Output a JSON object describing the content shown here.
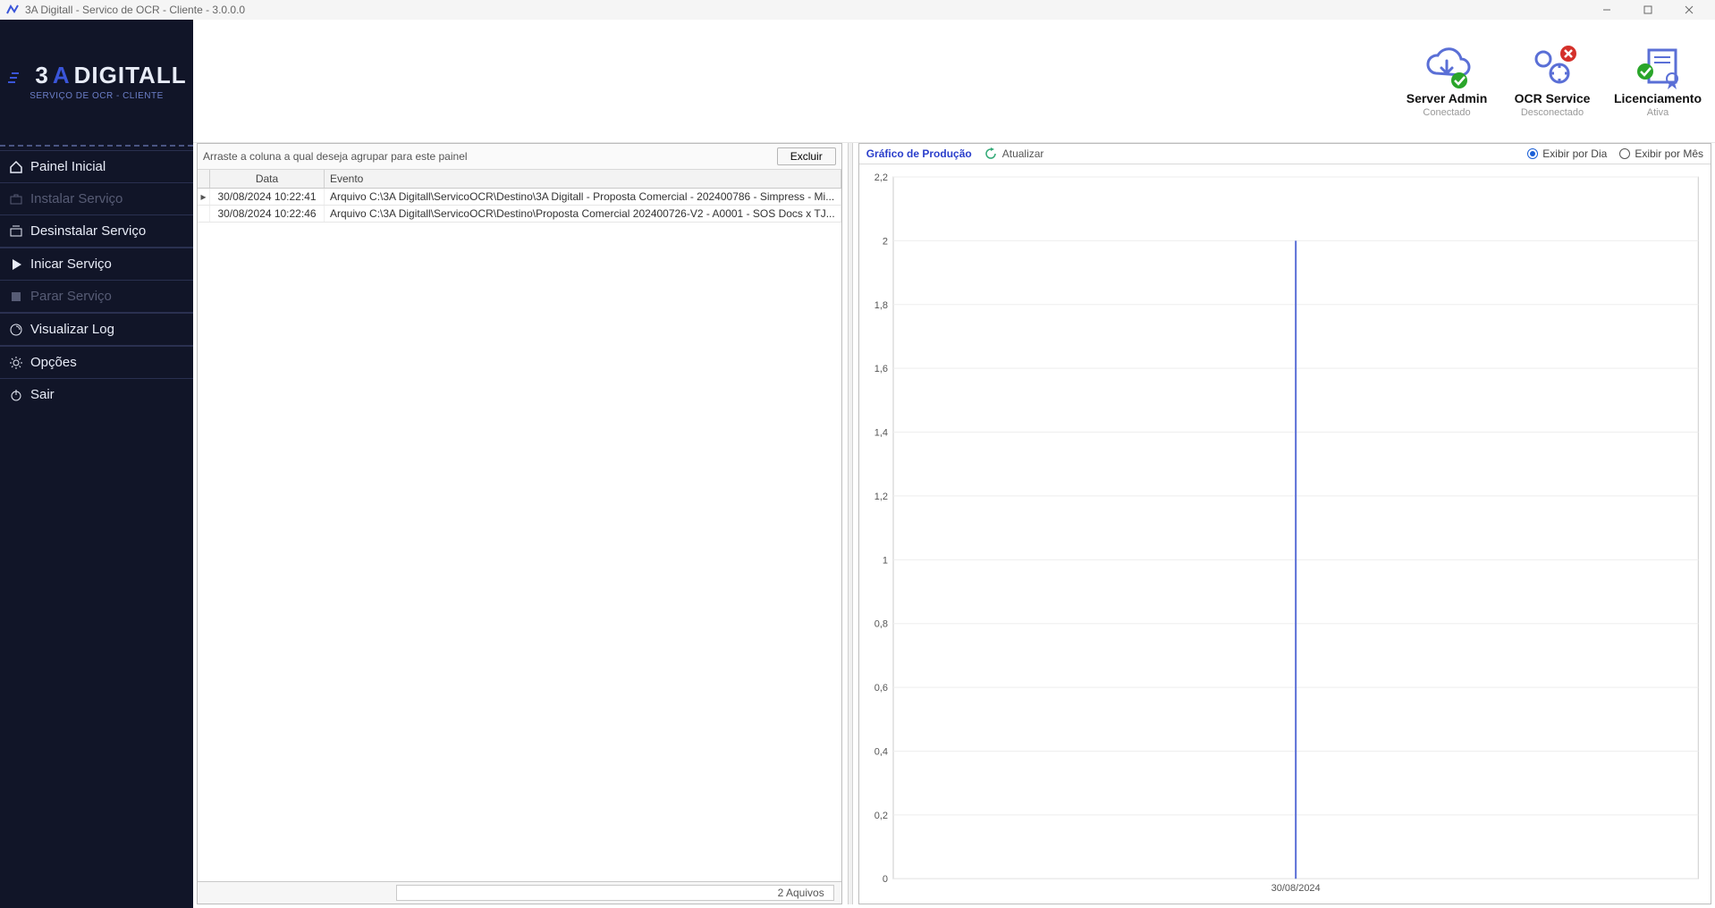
{
  "window": {
    "title": "3A Digitall - Servico de OCR - Cliente - 3.0.0.0"
  },
  "brand": {
    "name_prefix": "3",
    "name_accent": "A",
    "name_rest": "DIGITALL",
    "subtitle": "SERVIÇO DE OCR - CLIENTE"
  },
  "sidebar": {
    "items": [
      {
        "label": "Painel Inicial",
        "icon": "home-icon",
        "state": "active"
      },
      {
        "label": "Instalar Serviço",
        "icon": "install-icon",
        "state": "disabled"
      },
      {
        "label": "Desinstalar Serviço",
        "icon": "uninstall-icon",
        "state": "active"
      },
      {
        "label": "Inicar Serviço",
        "icon": "play-icon",
        "state": "active"
      },
      {
        "label": "Parar Serviço",
        "icon": "stop-icon",
        "state": "disabled"
      },
      {
        "label": "Visualizar Log",
        "icon": "log-icon",
        "state": "active"
      },
      {
        "label": "Opções",
        "icon": "gear-icon",
        "state": "active"
      },
      {
        "label": "Sair",
        "icon": "power-icon",
        "state": "active"
      }
    ]
  },
  "status_cards": [
    {
      "label": "Server Admin",
      "sub": "Conectado",
      "ok": true,
      "icon": "cloud-icon"
    },
    {
      "label": "OCR Service",
      "sub": "Desconectado",
      "ok": false,
      "icon": "gears-icon"
    },
    {
      "label": "Licenciamento",
      "sub": "Ativa",
      "ok": true,
      "icon": "certificate-icon"
    }
  ],
  "grid": {
    "group_hint": "Arraste a coluna a qual deseja agrupar para este painel",
    "delete_btn": "Excluir",
    "columns": {
      "data": "Data",
      "evento": "Evento"
    },
    "rows": [
      {
        "data": "30/08/2024 10:22:41",
        "evento": "Arquivo  C:\\3A Digitall\\ServicoOCR\\Destino\\3A Digitall - Proposta Comercial - 202400786 - Simpress - Mi..."
      },
      {
        "data": "30/08/2024 10:22:46",
        "evento": "Arquivo  C:\\3A Digitall\\ServicoOCR\\Destino\\Proposta Comercial 202400726-V2 - A0001 - SOS Docs x TJ..."
      }
    ],
    "footer": "2 Aquivos"
  },
  "chart": {
    "title": "Gráfico de Produção",
    "refresh": "Atualizar",
    "radio_day": "Exibir por Dia",
    "radio_month": "Exibir por Mês",
    "selected": "day"
  },
  "chart_data": {
    "type": "bar",
    "categories": [
      "30/08/2024"
    ],
    "values": [
      2
    ],
    "title": "Gráfico de Produção",
    "xlabel": "",
    "ylabel": "",
    "ylim": [
      0,
      2.2
    ],
    "yticks": [
      0,
      0.2,
      0.4,
      0.6,
      0.8,
      1,
      1.2,
      1.4,
      1.6,
      1.8,
      2,
      2.2
    ],
    "ytick_labels": [
      "0",
      "0,2",
      "0,4",
      "0,6",
      "0,8",
      "1",
      "1,2",
      "1,4",
      "1,6",
      "1,8",
      "2",
      "2,2"
    ]
  },
  "colors": {
    "accent": "#3a55d9",
    "chart_title": "#2a3ecb",
    "ok_badge": "#2aa52a",
    "err_badge": "#d4302a"
  }
}
